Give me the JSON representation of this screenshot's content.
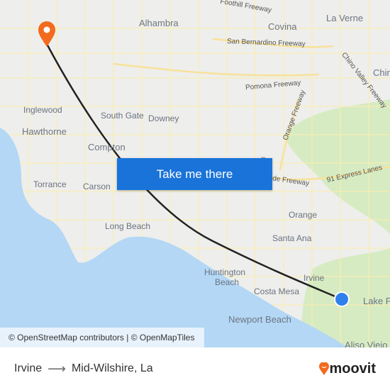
{
  "map": {
    "labels": {
      "alhambra": "Alhambra",
      "covina": "Covina",
      "la_verne": "La Verne",
      "chino": "Chin",
      "inglewood": "Inglewood",
      "hawthorne": "Hawthorne",
      "south_gate": "South Gate",
      "downey": "Downey",
      "compton": "Compton",
      "torrance": "Torrance",
      "carson": "Carson",
      "long_beach": "Long Beach",
      "orange": "Orange",
      "santa_ana": "Santa Ana",
      "huntington_beach_1": "Huntington",
      "huntington_beach_2": "Beach",
      "irvine": "Irvine",
      "costa_mesa": "Costa Mesa",
      "newport_beach": "Newport Beach",
      "lake_forest": "Lake F",
      "aliso_viejo": "Aliso Viejo",
      "anaheim_partial": "n",
      "foothill_fwy": "Foothill Freeway",
      "san_bernardino_fwy": "San Bernardino Freeway",
      "pomona_fwy": "Pomona Freeway",
      "orange_fwy": "Orange Freeway",
      "chino_valley_fwy": "Chino Valley Freeway",
      "riverside_fwy": "de Freeway",
      "express_lanes": "91 Express Lanes"
    },
    "colors": {
      "land": "#eeeeec",
      "water": "#b3d7f5",
      "park": "#cfe8b8",
      "road": "#fdf1b8",
      "route": "#222222",
      "origin": "#2f80ed",
      "destination": "#f26b1d",
      "button": "#1a73d9"
    },
    "origin_marker": "blue-dot",
    "destination_marker": "orange-pin"
  },
  "cta": {
    "label": "Take me there"
  },
  "attribution": "© OpenStreetMap contributors | © OpenMapTiles",
  "footer": {
    "from": "Irvine",
    "arrow": "arrow-right-icon",
    "to": "Mid-Wilshire, La",
    "brand": "moovit"
  }
}
